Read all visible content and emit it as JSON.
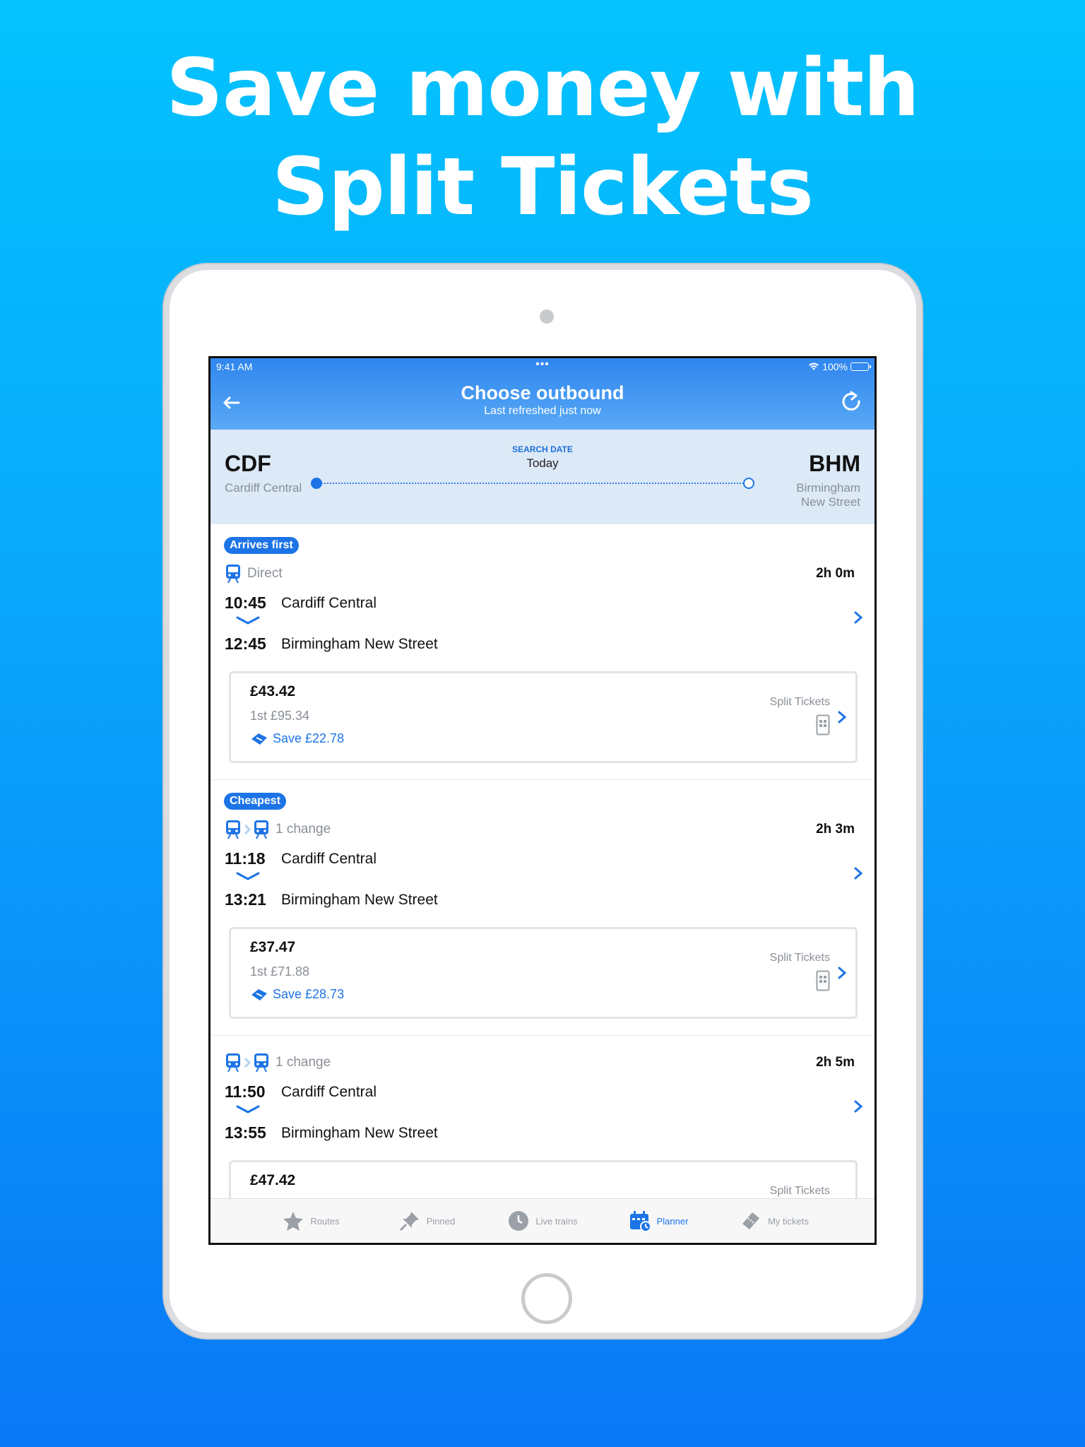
{
  "headline": {
    "line1": "Save money with",
    "line2": "Split Tickets"
  },
  "status_bar": {
    "time": "9:41 AM",
    "dots": "•••",
    "battery": "100%"
  },
  "header": {
    "title": "Choose outbound",
    "subtitle": "Last refreshed just now"
  },
  "route": {
    "origin_code": "CDF",
    "origin_name": "Cardiff Central",
    "dest_code": "BHM",
    "dest_name_line1": "Birmingham",
    "dest_name_line2": "New Street",
    "search_date_label": "SEARCH DATE",
    "search_date": "Today"
  },
  "journeys": [
    {
      "badge": "Arrives first",
      "changes": "Direct",
      "duration": "2h 0m",
      "depart_time": "10:45",
      "depart_station": "Cardiff Central",
      "arrive_time": "12:45",
      "arrive_station": "Birmingham New Street",
      "fare": {
        "price": "£43.42",
        "first_class": "1st £95.34",
        "save": "Save £22.78",
        "type": "Split Tickets"
      }
    },
    {
      "badge": "Cheapest",
      "changes": "1 change",
      "duration": "2h 3m",
      "depart_time": "11:18",
      "depart_station": "Cardiff Central",
      "arrive_time": "13:21",
      "arrive_station": "Birmingham New Street",
      "fare": {
        "price": "£37.47",
        "first_class": "1st £71.88",
        "save": "Save £28.73",
        "type": "Split Tickets"
      }
    },
    {
      "badge": "",
      "changes": "1 change",
      "duration": "2h 5m",
      "depart_time": "11:50",
      "depart_station": "Cardiff Central",
      "arrive_time": "13:55",
      "arrive_station": "Birmingham New Street",
      "fare": {
        "price": "£47.42",
        "first_class": "",
        "save": "",
        "type": "Split Tickets"
      }
    }
  ],
  "tabs": [
    {
      "label": "Routes",
      "icon": "star-icon"
    },
    {
      "label": "Pinned",
      "icon": "pin-icon"
    },
    {
      "label": "Live trains",
      "icon": "clock-icon"
    },
    {
      "label": "Planner",
      "icon": "calendar-icon",
      "active": true
    },
    {
      "label": "My tickets",
      "icon": "ticket-icon"
    }
  ],
  "colors": {
    "accent": "#1d74e6",
    "header_top": "#2f86ef",
    "route_bg": "#dce9f7"
  }
}
